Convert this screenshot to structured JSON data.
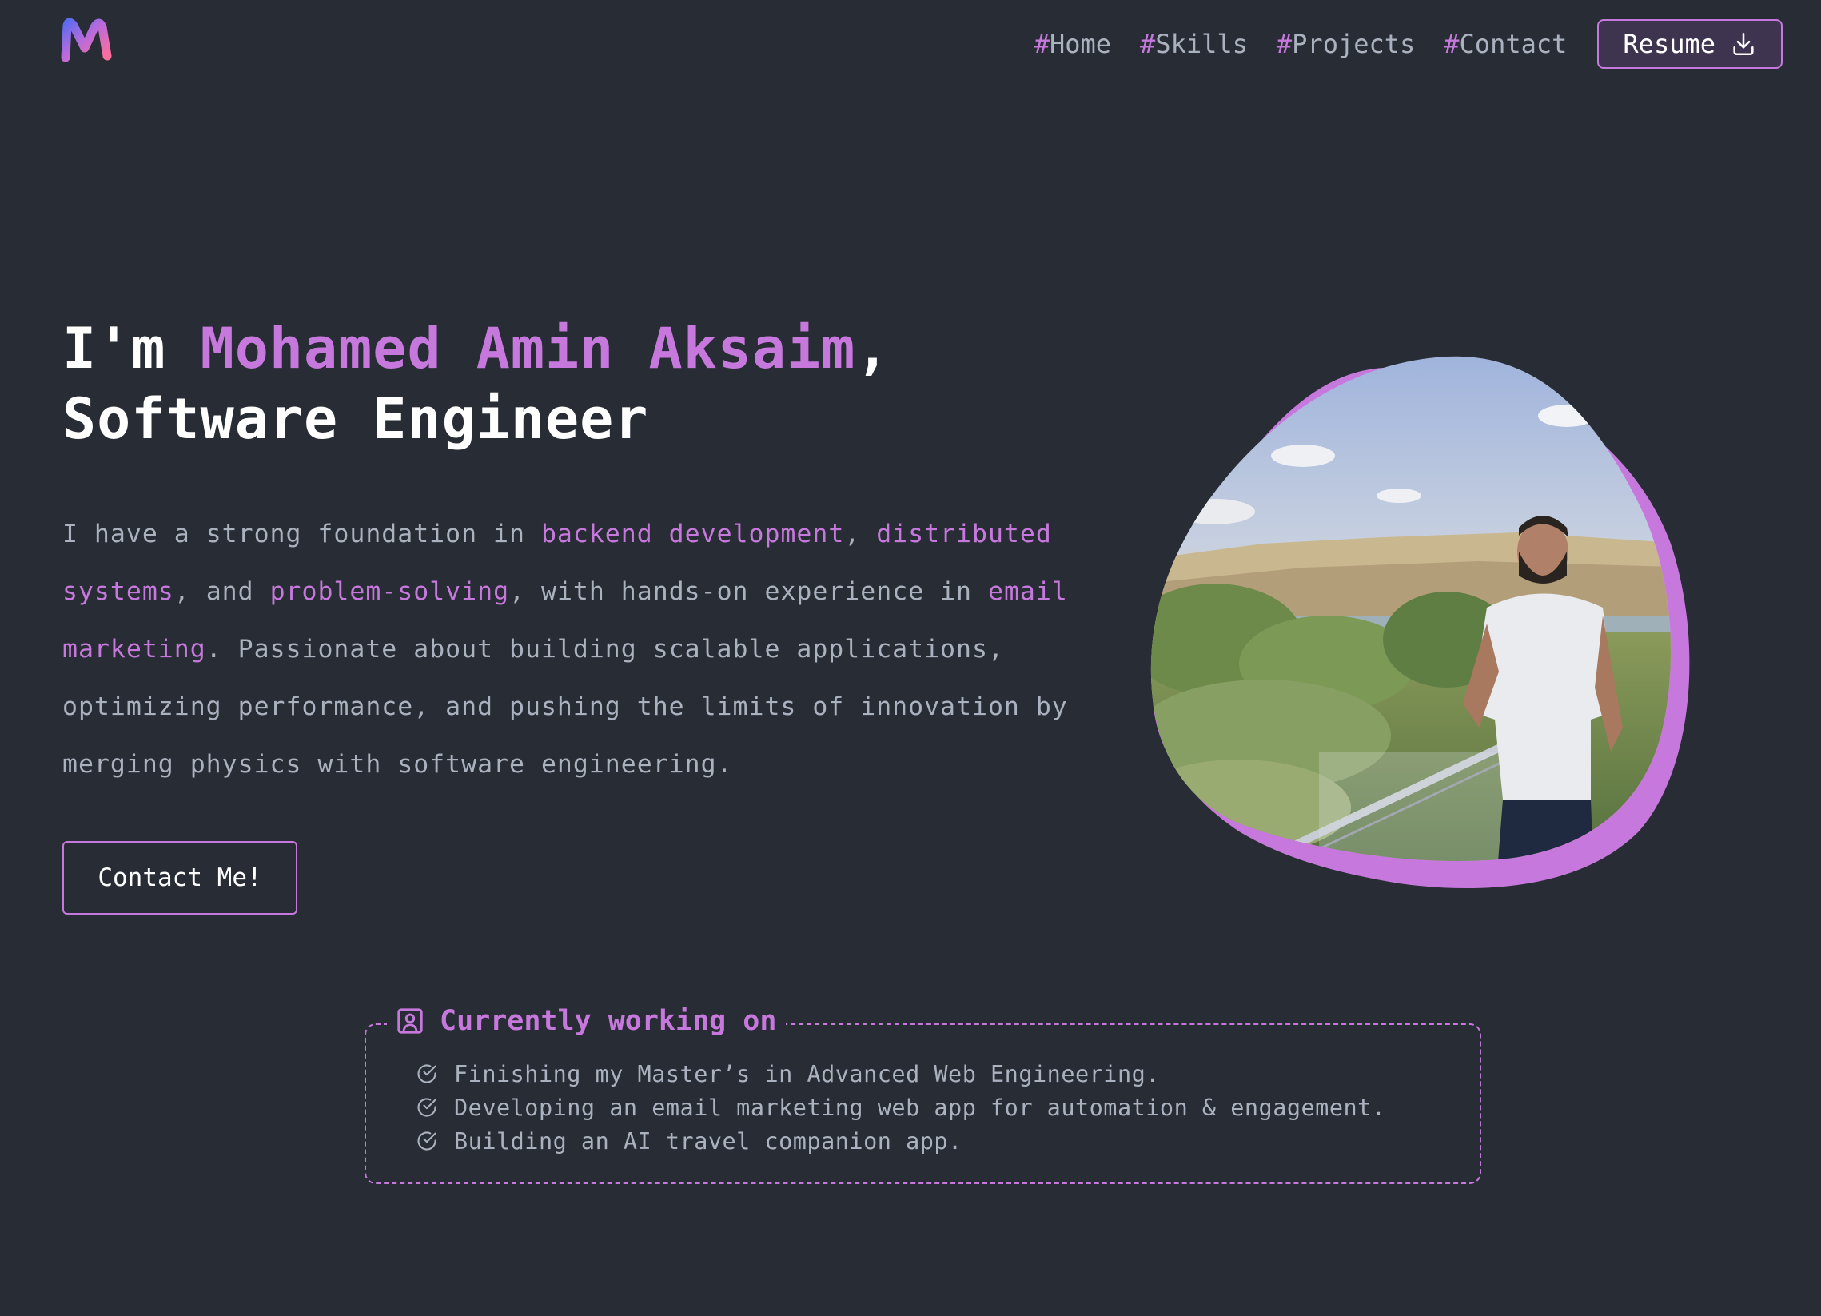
{
  "nav": {
    "logo_icon": "gradient-m-logo-icon",
    "links": [
      {
        "hash": "#",
        "label": "Home"
      },
      {
        "hash": "#",
        "label": "Skills"
      },
      {
        "hash": "#",
        "label": "Projects"
      },
      {
        "hash": "#",
        "label": "Contact"
      }
    ],
    "resume_label": "Resume",
    "resume_icon": "download-icon"
  },
  "hero": {
    "title_prefix": "I'm ",
    "name": "Mohamed Amin Aksaim",
    "title_comma": ",",
    "role": "Software Engineer",
    "description": {
      "p1": "I have a strong foundation in ",
      "h1": "backend development",
      "p2": ", ",
      "h2": "distributed systems",
      "p3": ", and ",
      "h3": "problem-solving",
      "p4": ", with hands-on experience in ",
      "h4": "email marketing",
      "p5": ". Passionate about building scalable applications, optimizing performance, and pushing the limits of innovation by merging physics with software engineering."
    },
    "contact_button": "Contact Me!"
  },
  "working_on": {
    "icon": "portrait-user-icon",
    "title": "Currently working on",
    "item_icon": "check-circle-icon",
    "items": [
      "Finishing my Master’s in Advanced Web Engineering.",
      "Developing an email marketing web app for automation & engagement.",
      "Building an AI travel companion app."
    ]
  },
  "colors": {
    "background": "#282c34",
    "accent": "#c778dd",
    "text_muted": "#abb2bf",
    "text": "#ffffff"
  }
}
